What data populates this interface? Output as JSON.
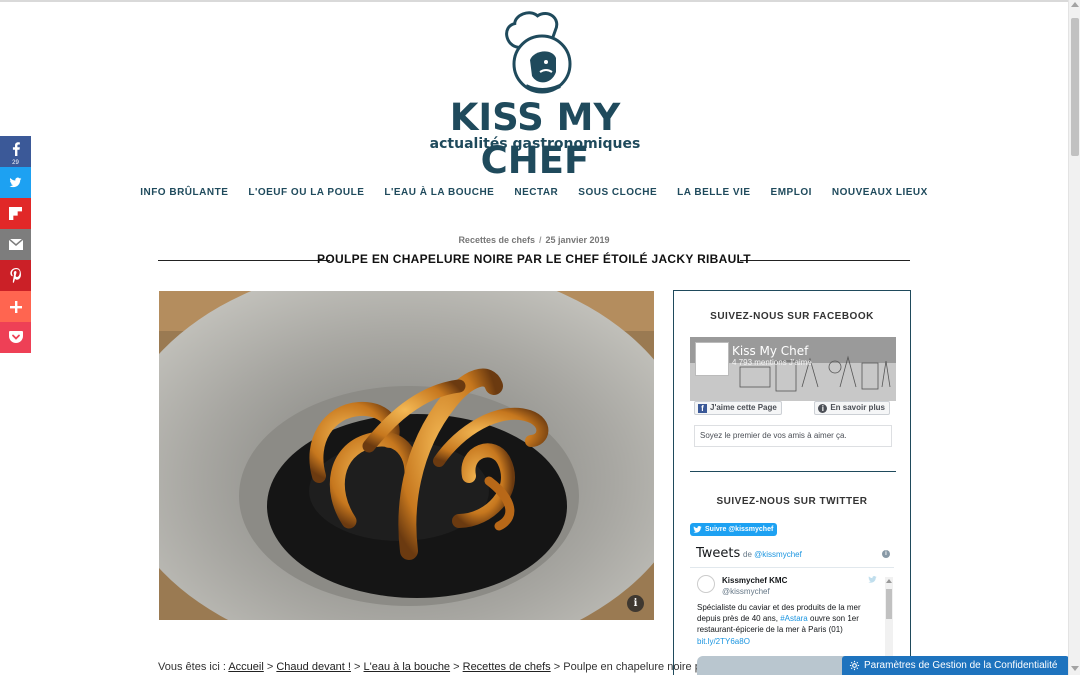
{
  "site": {
    "title": "KISS MY CHEF",
    "tagline": "actualités gastronomiques"
  },
  "nav": {
    "items": [
      "INFO BRÛLANTE",
      "L'OEUF OU LA POULE",
      "L'EAU À LA BOUCHE",
      "NECTAR",
      "SOUS CLOCHE",
      "LA BELLE VIE",
      "EMPLOI",
      "NOUVEAUX LIEUX"
    ]
  },
  "article": {
    "category": "Recettes de chefs",
    "separator": "/",
    "date": "25 janvier 2019",
    "title": "POULPE EN CHAPELURE NOIRE PAR LE CHEF ÉTOILÉ JACKY RIBAULT",
    "image_info": "i"
  },
  "breadcrumb": {
    "prefix": "Vous êtes ici :",
    "items": [
      "Accueil",
      "Chaud devant !",
      "L'eau à la bouche",
      "Recettes de chefs"
    ],
    "sep": ">",
    "current": "Poulpe en chapelure noire par"
  },
  "sidebar": {
    "facebook": {
      "heading": "SUIVEZ-NOUS SUR FACEBOOK",
      "page_name": "Kiss My Chef",
      "likes": "4 793 mentions J'aime",
      "like_button": "J'aime cette Page",
      "info_button": "En savoir plus",
      "friends_text": "Soyez le premier de vos amis à aimer ça."
    },
    "twitter": {
      "heading": "SUIVEZ-NOUS SUR TWITTER",
      "follow_button": "Suivre @kissmychef",
      "timeline_title": "Tweets",
      "timeline_by": "de",
      "timeline_handle": "@kissmychef",
      "tweet_name": "Kissmychef KMC",
      "tweet_handle": "@kissmychef",
      "tweet_text_1": "Spécialiste du caviar et des produits de la mer depuis près de 40 ans,",
      "tweet_hashtag": "#Astara",
      "tweet_text_2": "ouvre son 1er restaurant-épicerie de la mer à Paris (01)",
      "tweet_link": "bit.ly/2TY6a8O"
    }
  },
  "share": {
    "facebook_count": "29",
    "colors": {
      "facebook": "#3b5998",
      "twitter": "#1da1f2",
      "flipboard": "#e12828",
      "email": "#7d7d7d",
      "pinterest": "#cb2027",
      "more": "#ff6550",
      "pocket": "#ee4056"
    }
  },
  "privacy": {
    "label": "Paramètres de Gestion de la Confidentialité"
  },
  "colors": {
    "brand": "#1f4a5c",
    "privacy_bg": "#1e73be"
  }
}
